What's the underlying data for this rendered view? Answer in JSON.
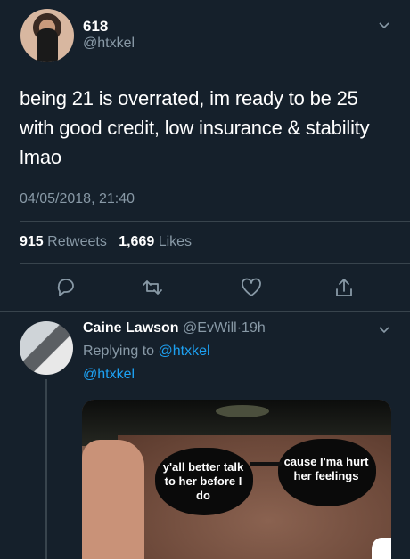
{
  "tweet": {
    "display_name": "618",
    "handle": "@htxkel",
    "text": "being 21 is overrated, im ready to be 25 with good credit, low insurance & stability lmao",
    "timestamp": "04/05/2018, 21:40",
    "retweets_count": "915",
    "retweets_label": "Retweets",
    "likes_count": "1,669",
    "likes_label": "Likes"
  },
  "actions": {
    "reply_icon": "reply-icon",
    "retweet_icon": "retweet-icon",
    "like_icon": "heart-icon",
    "share_icon": "share-icon"
  },
  "reply": {
    "display_name": "Caine Lawson",
    "handle": "@EvWill",
    "separator": "·",
    "time": "19h",
    "replying_prefix": "Replying to",
    "replying_handle": "@htxkel",
    "mention": "@htxkel",
    "media": {
      "left_lens_text": "y'all better talk to her before I do",
      "right_lens_text": "cause I'ma hurt her feelings"
    }
  },
  "colors": {
    "background": "#15202b",
    "secondary_text": "#8899a6",
    "accent": "#1da1f2",
    "divider": "#38444d"
  }
}
